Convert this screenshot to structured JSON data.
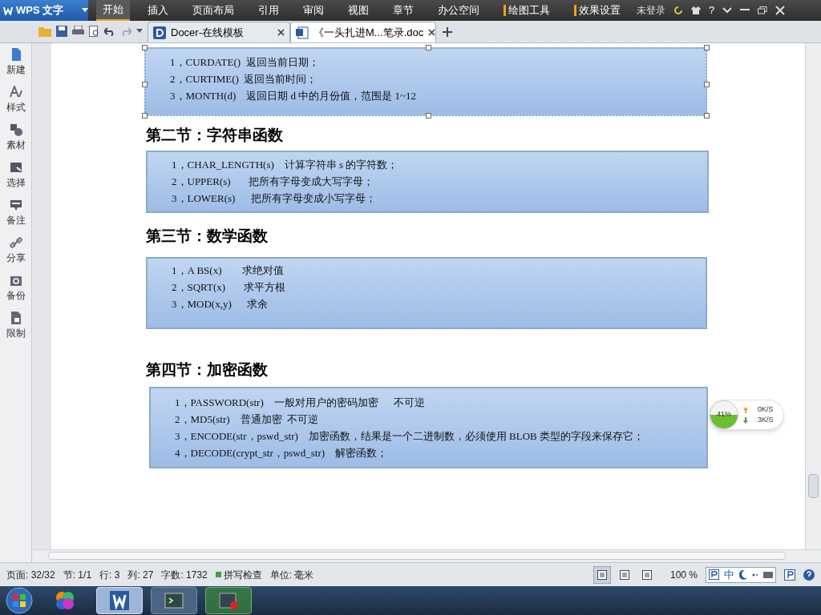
{
  "menubar": {
    "app_button": "WPS 文字",
    "tabs": [
      {
        "label": "开始",
        "selected": true,
        "kind": "ribbon"
      },
      {
        "label": "插入",
        "selected": false,
        "kind": "ribbon"
      },
      {
        "label": "页面布局",
        "selected": false,
        "kind": "ribbon"
      },
      {
        "label": "引用",
        "selected": false,
        "kind": "ribbon"
      },
      {
        "label": "审阅",
        "selected": false,
        "kind": "ribbon"
      },
      {
        "label": "视图",
        "selected": false,
        "kind": "ribbon"
      },
      {
        "label": "章节",
        "selected": false,
        "kind": "ribbon"
      },
      {
        "label": "办公空间",
        "selected": false,
        "kind": "ribbon"
      },
      {
        "label": "绘图工具",
        "selected": false,
        "kind": "context"
      },
      {
        "label": "效果设置",
        "selected": false,
        "kind": "context"
      }
    ],
    "login": "未登录",
    "help": "?"
  },
  "doc_tabs": [
    {
      "label": "Docer-在线模板",
      "selected": false,
      "kind": "docer"
    },
    {
      "label": "《一头扎进M...笔录.doc",
      "selected": true,
      "kind": "doc"
    }
  ],
  "sidebar": {
    "items": [
      {
        "label": "新建"
      },
      {
        "label": "样式"
      },
      {
        "label": "素材"
      },
      {
        "label": "选择"
      },
      {
        "label": "备注"
      },
      {
        "label": "分享"
      },
      {
        "label": "备份"
      },
      {
        "label": "限制"
      }
    ]
  },
  "document": {
    "blocks": [
      {
        "kind": "box",
        "selected": true,
        "lines": [
          "1，CURDATE()  返回当前日期；",
          "2，CURTIME()  返回当前时间；",
          "3，MONTH(d)    返回日期 d 中的月份值，范围是 1~12"
        ]
      },
      {
        "kind": "heading",
        "text": "第二节：字符串函数"
      },
      {
        "kind": "box",
        "selected": false,
        "lines": [
          "1，CHAR_LENGTH(s)    计算字符串 s 的字符数；",
          "2，UPPER(s)       把所有字母变成大写字母；",
          "3，LOWER(s)      把所有字母变成小写字母；"
        ]
      },
      {
        "kind": "heading",
        "text": "第三节：数学函数"
      },
      {
        "kind": "box",
        "selected": false,
        "lines": [
          "1，A BS(x)        求绝对值",
          "2，SQRT(x)       求平方根",
          "3，MOD(x,y)      求余"
        ]
      },
      {
        "kind": "heading",
        "text": "第四节：加密函数"
      },
      {
        "kind": "box",
        "selected": false,
        "lines": [
          "1，PASSWORD(str)    一般对用户的密码加密      不可逆",
          "2，MD5(str)    普通加密  不可逆",
          "3，ENCODE(str，pswd_str)    加密函数，结果是一个二进制数，必须使用 BLOB 类型的字段来保存它；",
          "4，DECODE(crypt_str，pswd_str)    解密函数；"
        ]
      }
    ]
  },
  "speed_widget": {
    "percent": "41%",
    "upload": "0K/S",
    "download": "3K/S"
  },
  "status_bar": {
    "items": [
      "页面: 32/32",
      "节: 1/1",
      "行: 3",
      "列: 27",
      "字数: 1732"
    ],
    "spell_check": "拼写检查",
    "unit": "单位: 毫米",
    "zoom": "100 %",
    "views": [
      {
        "selected": true
      },
      {
        "selected": false
      },
      {
        "selected": false
      }
    ],
    "ime": "中"
  },
  "taskbar": {
    "apps": [
      {
        "selected": false
      },
      {
        "selected": true
      },
      {
        "selected": false
      },
      {
        "selected": false
      }
    ]
  }
}
